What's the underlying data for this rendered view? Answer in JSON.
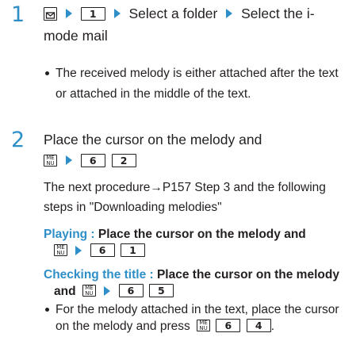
{
  "step1": {
    "number": "1",
    "key1": "1",
    "text_a": "Select a folder",
    "text_b": "Select the i-",
    "text_c": "mode mail",
    "note_line1": "The received melody is either attached after the text",
    "note_line2": "or attached in the middle of the text."
  },
  "step2": {
    "number": "2",
    "line1": "Place the cursor on the melody and",
    "key_a": "6",
    "key_b": "2",
    "next_line1": "The next procedure→P157 Step 3 and the following",
    "next_line2": "steps in \"Downloading melodies\""
  },
  "playing": {
    "label": "Playing : ",
    "text": "Place the cursor on the melody and",
    "key_a": "6",
    "key_b": "1"
  },
  "checking": {
    "label": "Checking the title : ",
    "text": "Place the cursor on the melody",
    "text2": "and",
    "key_a": "6",
    "key_b": "5"
  },
  "bullet_note": {
    "line1": "For the melody attached in the text, place the cursor",
    "line2": "on the melody and press",
    "key_a": "6",
    "key_b": "4",
    "end": "."
  },
  "menu_key_text": {
    "top": "ME",
    "bottom": "NU"
  },
  "colors": {
    "accent": "#2e8fc8",
    "text": "#231f20"
  }
}
